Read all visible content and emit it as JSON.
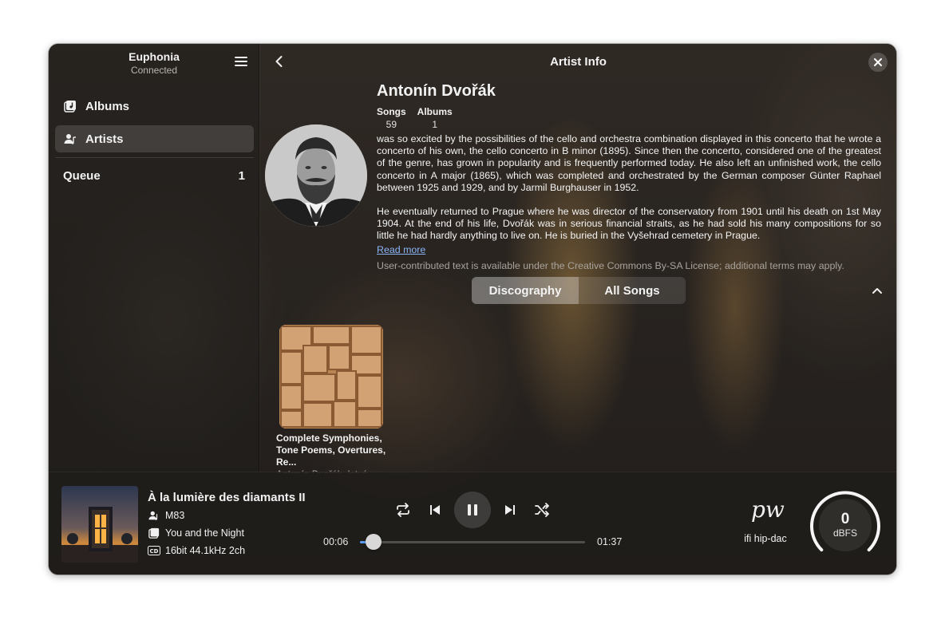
{
  "app": {
    "title": "Euphonia",
    "status": "Connected"
  },
  "sidebar": {
    "items": [
      {
        "label": "Albums",
        "icon": "albums-icon"
      },
      {
        "label": "Artists",
        "icon": "artist-icon"
      }
    ],
    "queue": {
      "label": "Queue",
      "count": "1"
    }
  },
  "main": {
    "header_title": "Artist Info",
    "artist": {
      "name": "Antonín Dvořák",
      "stats": [
        {
          "label": "Songs",
          "value": "59"
        },
        {
          "label": "Albums",
          "value": "1"
        }
      ],
      "bio_paragraphs": [
        "was so excited by the possibilities of the cello and orchestra combination displayed in this concerto that he wrote a concerto of his own, the cello concerto in B minor (1895). Since then the concerto, considered one of the greatest of the genre, has grown in popularity and is frequently performed today. He also left an unfinished work, the cello concerto in A major (1865), which was completed and orchestrated by the German composer Günter Raphael between 1925 and 1929, and by Jarmil Burghauser in 1952.",
        "He eventually returned to Prague where he was director of the conservatory from 1901 until his death on 1st May 1904. At the end of his life, Dvořák was in serious financial straits, as he had sold his many compositions for so little he had hardly anything to live on. He is buried in the Vyšehrad cemetery in Prague."
      ],
      "read_more": "Read more",
      "license": "User-contributed text is available under the Creative Commons By-SA License; additional terms may apply."
    },
    "tabs": [
      {
        "label": "Discography",
        "active": true
      },
      {
        "label": "All Songs",
        "active": false
      }
    ],
    "albums": [
      {
        "title": "Complete Symphonies, Tone Poems, Overtures, Re...",
        "artist": "Antonín Dvořák, Istvá..."
      }
    ]
  },
  "player": {
    "track_title": "À la lumière des diamants II",
    "artist": "M83",
    "album": "You and the Night",
    "format": "16bit 44.1kHz 2ch",
    "elapsed": "00:06",
    "duration": "01:37",
    "progress": 0.062,
    "output_device": "ifi hip-dac",
    "output_logo": "pw",
    "level_value": "0",
    "level_unit": "dBFS"
  },
  "colors": {
    "accent": "#5b9ef5",
    "link": "#8ab4f8"
  }
}
